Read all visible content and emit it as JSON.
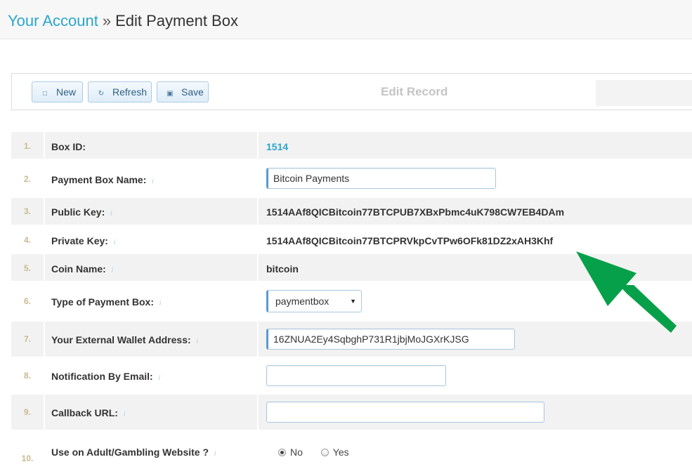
{
  "breadcrumb": {
    "parent": "Your Account",
    "separator": "»",
    "current": "Edit Payment Box"
  },
  "toolbar": {
    "new_label": "New",
    "refresh_label": "Refresh",
    "save_label": "Save",
    "title": "Edit Record"
  },
  "info_glyph": "i",
  "fields": [
    {
      "num": "1.",
      "label": "Box ID:",
      "value": "1514"
    },
    {
      "num": "2.",
      "label": "Payment Box Name:",
      "value": "Bitcoin Payments"
    },
    {
      "num": "3.",
      "label": "Public Key:",
      "value": "1514AAf8QICBitcoin77BTCPUB7XBxPbmc4uK798CW7EB4DAm"
    },
    {
      "num": "4.",
      "label": "Private Key:",
      "value": "1514AAf8QICBitcoin77BTCPRVkpCvTPw6OFk81DZ2xAH3Khf"
    },
    {
      "num": "5.",
      "label": "Coin Name:",
      "value": "bitcoin"
    },
    {
      "num": "6.",
      "label": "Type of Payment Box:",
      "value": "paymentbox"
    },
    {
      "num": "7.",
      "label": "Your External Wallet Address:",
      "value": "16ZNUA2Ey4SqbghP731R1jbjMoJGXrKJSG"
    },
    {
      "num": "8.",
      "label": "Notification By Email:",
      "value": ""
    },
    {
      "num": "9.",
      "label": "Callback URL:",
      "value": ""
    },
    {
      "num": "10.",
      "label": "Use on Adult/Gambling Website ?",
      "options": [
        "No",
        "Yes"
      ],
      "selected": "No"
    }
  ],
  "colors": {
    "link": "#2ba6cb",
    "arrow": "#07a04a",
    "row_shade": "#f2f2f2",
    "button_border": "#a9cbe3"
  },
  "icons": {
    "new": "file-icon",
    "refresh": "refresh-icon",
    "save": "save-icon",
    "annotation": "green-arrow-icon"
  }
}
